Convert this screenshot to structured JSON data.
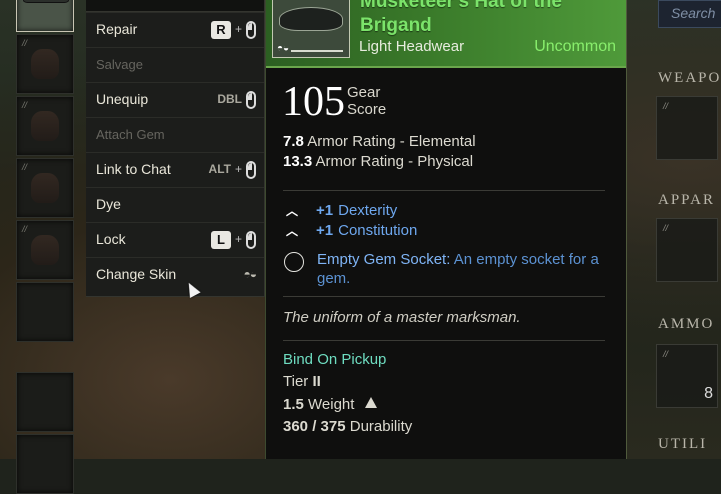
{
  "context_menu": {
    "header": "",
    "items": [
      {
        "label": "Repair",
        "enabled": true,
        "hint": {
          "key": "R",
          "plus": "+",
          "icon": "mouse-icon"
        }
      },
      {
        "label": "Salvage",
        "enabled": false
      },
      {
        "label": "Unequip",
        "enabled": true,
        "hint": {
          "text": "DBL",
          "icon": "mouse-icon"
        }
      },
      {
        "label": "Attach Gem",
        "enabled": false
      },
      {
        "label": "Link to Chat",
        "enabled": true,
        "hint": {
          "text": "ALT",
          "plus": "+",
          "icon": "mouse-icon"
        }
      },
      {
        "label": "Dye",
        "enabled": true
      },
      {
        "label": "Lock",
        "enabled": true,
        "hint": {
          "key": "L",
          "plus": "+",
          "icon": "mouse-icon"
        }
      },
      {
        "label": "Change Skin",
        "enabled": true,
        "hint": {
          "icon": "mask-icon"
        }
      }
    ]
  },
  "tooltip": {
    "name_line1": "Musketeer's Hat of the",
    "name_line2": "Brigand",
    "item_type": "Light Headwear",
    "rarity": "Uncommon",
    "gear_score": "105",
    "gear_score_label": "Gear Score",
    "stats": [
      {
        "value": "7.8",
        "label": "Armor Rating - Elemental"
      },
      {
        "value": "13.3",
        "label": "Armor Rating - Physical"
      }
    ],
    "perks": [
      {
        "value": "+1",
        "label": "Dexterity"
      },
      {
        "value": "+1",
        "label": "Constitution"
      }
    ],
    "gem_socket": {
      "title": "Empty Gem Socket:",
      "description": "An empty socket for a gem."
    },
    "flavor_text": "The uniform of a master marksman.",
    "binding": "Bind On Pickup",
    "tier_label": "Tier",
    "tier_value": "II",
    "weight_value": "1.5",
    "weight_label": "Weight",
    "durability": "360 / 375",
    "durability_label": "Durability"
  },
  "right_panel": {
    "search_placeholder": "Search",
    "sections": [
      "WEAPO",
      "APPAR",
      "AMMO",
      "UTILI"
    ],
    "ammo_quantity": "8"
  },
  "colors": {
    "rarity_green": "#88ee6c",
    "perk_blue": "#6ea7ee",
    "bind_teal": "#6edcc0"
  }
}
